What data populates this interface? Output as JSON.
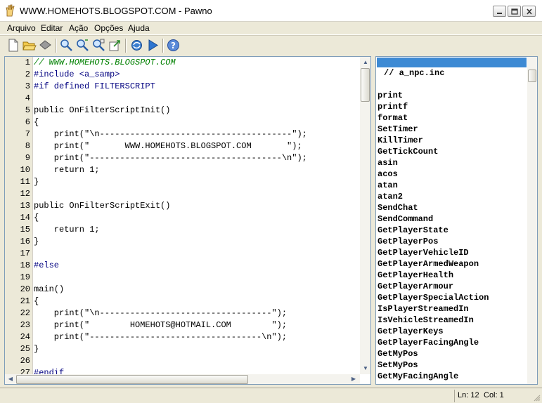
{
  "window": {
    "title": "WWW.HOMEHOTS.BLOGSPOT.COM - Pawno",
    "app_icon": "pawno-hand-icon",
    "buttons": [
      "minimize-icon",
      "maximize-icon",
      "close-icon"
    ]
  },
  "menu": {
    "items": [
      {
        "label": "Arquivo"
      },
      {
        "label": "Editar"
      },
      {
        "label": "Ação"
      },
      {
        "label": "Opções"
      },
      {
        "label": "Ajuda"
      }
    ]
  },
  "toolbar": {
    "buttons": [
      {
        "icon": "new-file-icon"
      },
      {
        "icon": "open-folder-icon"
      },
      {
        "icon": "save-disk-icon"
      },
      {
        "icon": "find-icon"
      },
      {
        "icon": "find-next-icon"
      },
      {
        "icon": "replace-icon"
      },
      {
        "icon": "goto-icon"
      },
      {
        "icon": "compile-icon"
      },
      {
        "icon": "run-icon"
      },
      {
        "icon": "help-icon"
      }
    ]
  },
  "editor": {
    "line_numbers": [
      "1",
      "2",
      "3",
      "4",
      "5",
      "6",
      "7",
      "8",
      "9",
      "10",
      "11",
      "12",
      "13",
      "14",
      "15",
      "16",
      "17",
      "18",
      "19",
      "20",
      "21",
      "22",
      "23",
      "24",
      "25",
      "26",
      "27"
    ],
    "lines": [
      {
        "text": "// WWW.HOMEHOTS.BLOGSPOT.COM",
        "kind": "comment"
      },
      {
        "text": "#include <a_samp>",
        "kind": "pre"
      },
      {
        "text": "#if defined FILTERSCRIPT",
        "kind": "pre"
      },
      {
        "text": "",
        "kind": "plain"
      },
      {
        "text": "public OnFilterScriptInit()",
        "kind": "plain"
      },
      {
        "text": "{",
        "kind": "plain"
      },
      {
        "text": "    print(\"\\n--------------------------------------\");",
        "kind": "plain"
      },
      {
        "text": "    print(\"       WWW.HOMEHOTS.BLOGSPOT.COM       \");",
        "kind": "plain"
      },
      {
        "text": "    print(\"--------------------------------------\\n\");",
        "kind": "plain"
      },
      {
        "text": "    return 1;",
        "kind": "plain"
      },
      {
        "text": "}",
        "kind": "plain"
      },
      {
        "text": "",
        "kind": "plain"
      },
      {
        "text": "public OnFilterScriptExit()",
        "kind": "plain"
      },
      {
        "text": "{",
        "kind": "plain"
      },
      {
        "text": "    return 1;",
        "kind": "plain"
      },
      {
        "text": "}",
        "kind": "plain"
      },
      {
        "text": "",
        "kind": "plain"
      },
      {
        "text": "#else",
        "kind": "pre"
      },
      {
        "text": "",
        "kind": "plain"
      },
      {
        "text": "main()",
        "kind": "plain"
      },
      {
        "text": "{",
        "kind": "plain"
      },
      {
        "text": "    print(\"\\n----------------------------------\");",
        "kind": "plain"
      },
      {
        "text": "    print(\"        HOMEHOTS@HOTMAIL.COM        \");",
        "kind": "plain"
      },
      {
        "text": "    print(\"----------------------------------\\n\");",
        "kind": "plain"
      },
      {
        "text": "}",
        "kind": "plain"
      },
      {
        "text": "",
        "kind": "plain"
      },
      {
        "text": "#endif",
        "kind": "pre"
      }
    ]
  },
  "function_list": {
    "include": "// a_npc.inc",
    "items": [
      "print",
      "printf",
      "format",
      "SetTimer",
      "KillTimer",
      "GetTickCount",
      "asin",
      "acos",
      "atan",
      "atan2",
      "SendChat",
      "SendCommand",
      "GetPlayerState",
      "GetPlayerPos",
      "GetPlayerVehicleID",
      "GetPlayerArmedWeapon",
      "GetPlayerHealth",
      "GetPlayerArmour",
      "GetPlayerSpecialAction",
      "IsPlayerStreamedIn",
      "IsVehicleStreamedIn",
      "GetPlayerKeys",
      "GetPlayerFacingAngle",
      "GetMyPos",
      "SetMyPos",
      "GetMyFacingAngle"
    ]
  },
  "status": {
    "line": "Ln: 12",
    "col": "Col: 1"
  },
  "colors": {
    "comment": "#008000",
    "keyword": "#000080",
    "selection": "#3d8ad4"
  }
}
